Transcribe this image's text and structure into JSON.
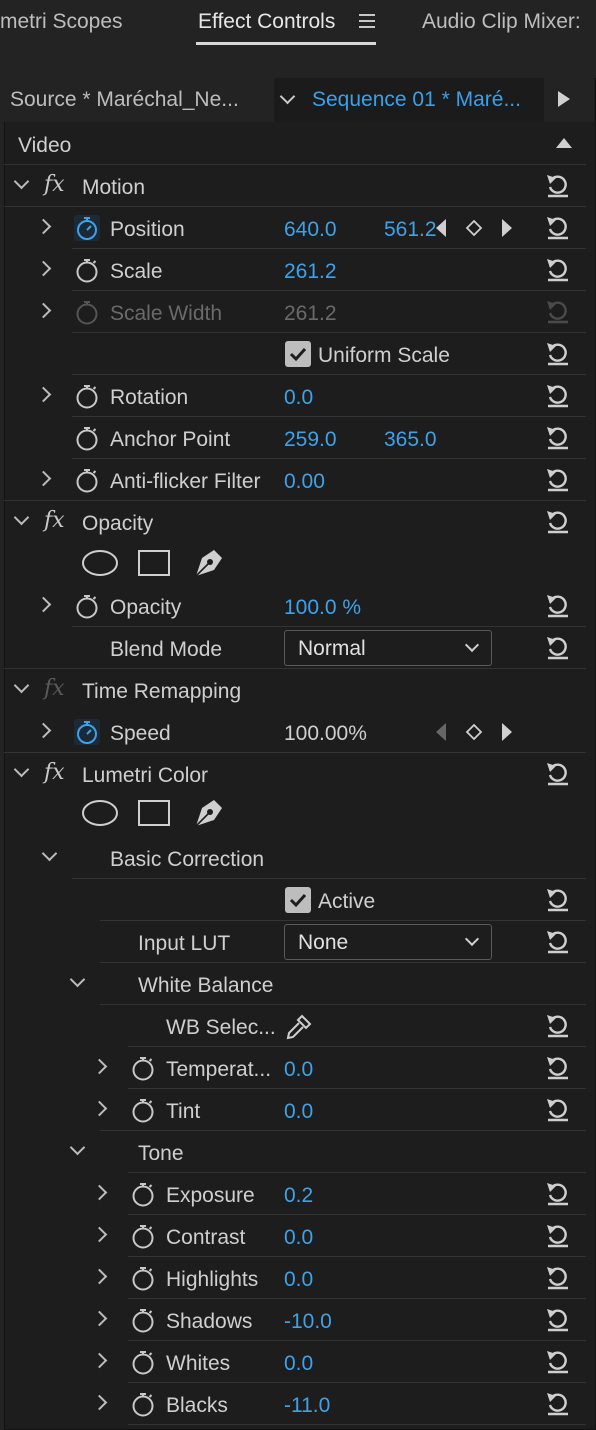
{
  "tabs": {
    "lumetri_scopes": "metri Scopes",
    "effect_controls": "Effect Controls",
    "audio_clip_mixer": "Audio Clip Mixer:"
  },
  "subheader": {
    "source": "Source * Maréchal_Ne...",
    "sequence": "Sequence 01 * Maré..."
  },
  "video_label": "Video",
  "motion": {
    "title": "Motion",
    "position": {
      "label": "Position",
      "x": "640.0",
      "y": "561.2"
    },
    "scale": {
      "label": "Scale",
      "value": "261.2"
    },
    "scale_width": {
      "label": "Scale Width",
      "value": "261.2"
    },
    "uniform_scale": "Uniform Scale",
    "rotation": {
      "label": "Rotation",
      "value": "0.0"
    },
    "anchor_point": {
      "label": "Anchor Point",
      "x": "259.0",
      "y": "365.0"
    },
    "anti_flicker": {
      "label": "Anti-flicker Filter",
      "value": "0.00"
    }
  },
  "opacity": {
    "title": "Opacity",
    "opacity": {
      "label": "Opacity",
      "value": "100.0 %"
    },
    "blend_mode": {
      "label": "Blend Mode",
      "value": "Normal"
    }
  },
  "time_remapping": {
    "title": "Time Remapping",
    "speed": {
      "label": "Speed",
      "value": "100.00%"
    }
  },
  "lumetri": {
    "title": "Lumetri Color",
    "basic_correction": "Basic Correction",
    "active": "Active",
    "input_lut": {
      "label": "Input LUT",
      "value": "None"
    },
    "white_balance": "White Balance",
    "wb_selector": "WB Selec...",
    "temperature": {
      "label": "Temperat...",
      "value": "0.0"
    },
    "tint": {
      "label": "Tint",
      "value": "0.0"
    },
    "tone": "Tone",
    "exposure": {
      "label": "Exposure",
      "value": "0.2"
    },
    "contrast": {
      "label": "Contrast",
      "value": "0.0"
    },
    "highlights": {
      "label": "Highlights",
      "value": "0.0"
    },
    "shadows": {
      "label": "Shadows",
      "value": "-10.0"
    },
    "whites": {
      "label": "Whites",
      "value": "0.0"
    },
    "blacks": {
      "label": "Blacks",
      "value": "-11.0"
    }
  },
  "colors": {
    "accent": "#3ea2ea",
    "panel": "#1d1d1d",
    "text": "#cfcfcf"
  }
}
